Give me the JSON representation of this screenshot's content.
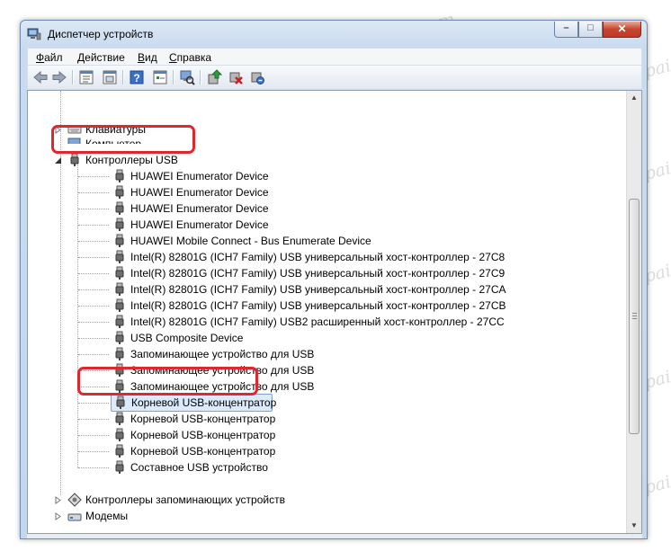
{
  "window": {
    "title": "Диспетчер устройств"
  },
  "menu": {
    "file": {
      "key": "Ф",
      "rest": "айл"
    },
    "action": {
      "key": "Д",
      "rest": "ействие"
    },
    "view": {
      "key": "В",
      "rest": "ид"
    },
    "help": {
      "key": "С",
      "rest": "правка"
    }
  },
  "toolbar_icons": [
    "back-icon",
    "forward-icon",
    "properties-list-icon",
    "computer-icon",
    "help-icon",
    "details-icon",
    "scan-hardware-icon",
    "update-driver-icon",
    "uninstall-icon",
    "disable-device-icon"
  ],
  "tree": {
    "keyboards": "Клавиатуры",
    "computer": "Компьютер",
    "usb_controllers": "Контроллеры USB",
    "usb_children": [
      "HUAWEI Enumerator Device",
      "HUAWEI Enumerator Device",
      "HUAWEI Enumerator Device",
      "HUAWEI Enumerator Device",
      "HUAWEI Mobile Connect - Bus Enumerate Device",
      "Intel(R) 82801G (ICH7 Family) USB универсальный хост-контроллер  - 27C8",
      "Intel(R) 82801G (ICH7 Family) USB универсальный хост-контроллер  - 27C9",
      "Intel(R) 82801G (ICH7 Family) USB универсальный хост-контроллер  - 27CA",
      "Intel(R) 82801G (ICH7 Family) USB универсальный хост-контроллер  - 27CB",
      "Intel(R) 82801G (ICH7 Family) USB2 расширенный хост-контроллер  - 27CC",
      "USB Composite Device",
      "Запоминающее устройство для USB",
      "Запоминающее устройство для USB",
      "Запоминающее устройство для USB",
      "Корневой USB-концентратор",
      "Корневой USB-концентратор",
      "Корневой USB-концентратор",
      "Корневой USB-концентратор",
      "Составное USB устройство"
    ],
    "storage_controllers": "Контроллеры запоминающих устройств",
    "modems": "Модемы"
  },
  "watermark": "Soringpcrepair.com",
  "colors": {
    "highlight": "#e0262f",
    "selection": "#dceafc"
  }
}
